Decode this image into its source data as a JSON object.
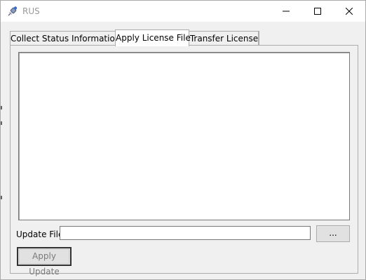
{
  "window": {
    "title": "RUS",
    "icon": "satellite-icon",
    "controls": [
      "minimize-icon",
      "maximize-icon",
      "close-icon"
    ]
  },
  "tabs": [
    {
      "label": "Collect Status Information",
      "selected": false
    },
    {
      "label": "Apply License File",
      "selected": true
    },
    {
      "label": "Transfer License",
      "selected": false
    }
  ],
  "apply_license": {
    "license_text": "",
    "update_file_label": "Update File",
    "update_file_value": "",
    "browse_label": "...",
    "apply_button_label": "Apply Update",
    "apply_button_enabled": false
  }
}
